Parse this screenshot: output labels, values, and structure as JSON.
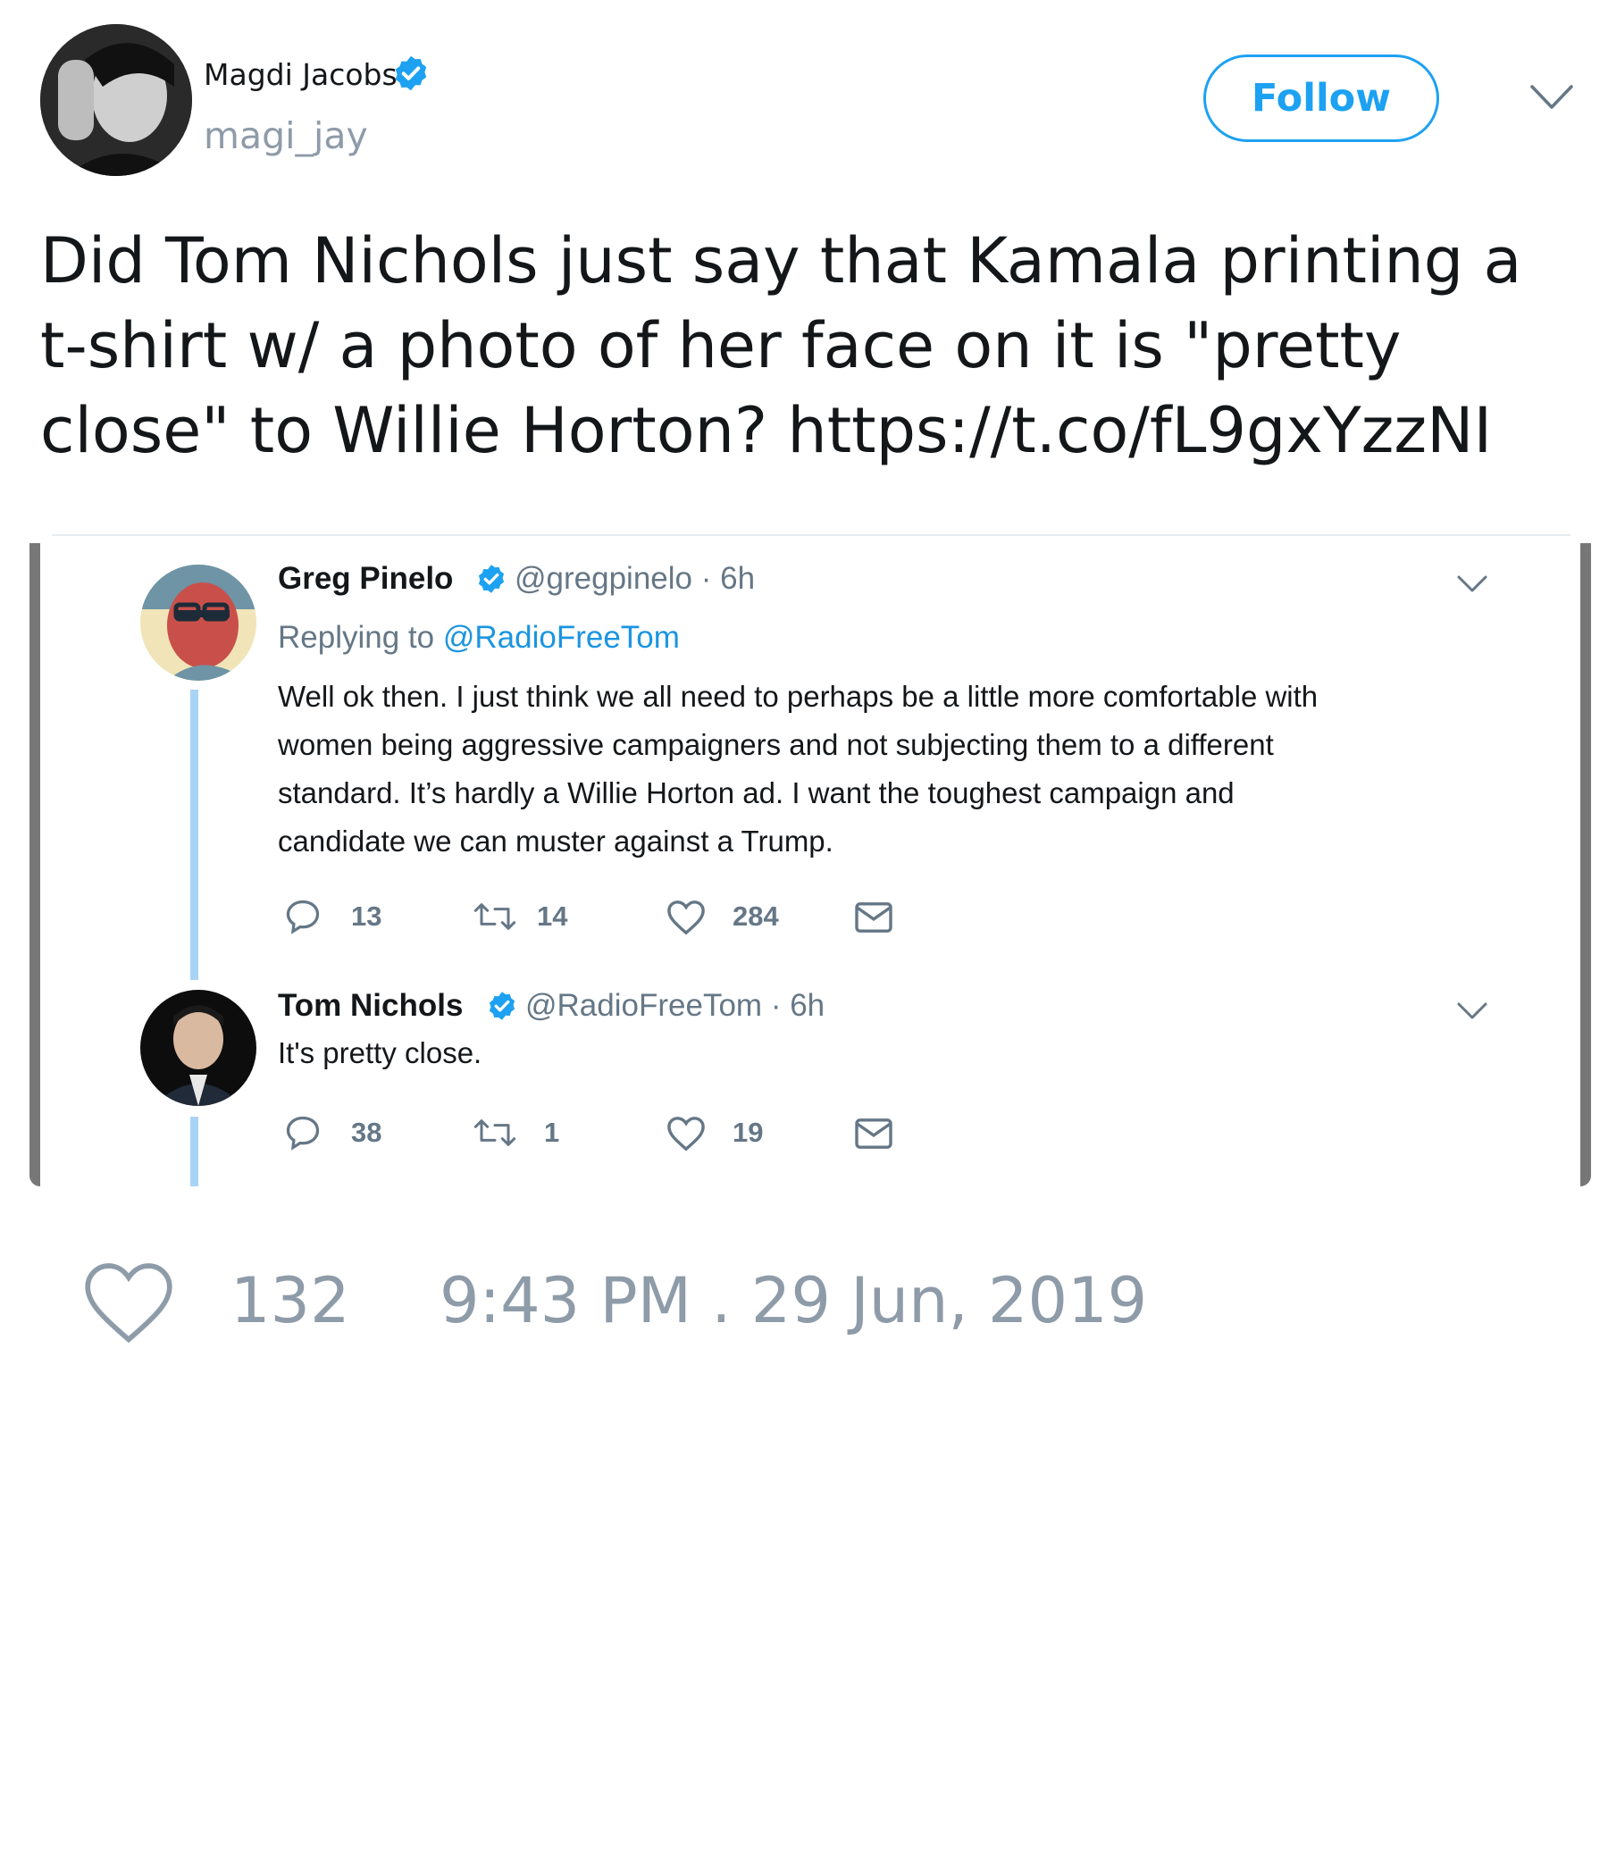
{
  "author": {
    "name": "Magdi Jacobs",
    "handle": "magi_jay",
    "verified": true
  },
  "follow_label": "Follow",
  "tweet_text": "Did Tom Nichols just say that Kamala printing a t-shirt w/ a photo of her face on it is \"pretty close\" to Willie Horton? https://t.co/fL9gxYzzNI",
  "embedded": {
    "reply1": {
      "name": "Greg Pinelo",
      "handle": "@gregpinelo",
      "time": "· 6h",
      "replying_prefix": "Replying to",
      "replying_to": "@RadioFreeTom",
      "lines": [
        "Well ok then. I just think we all need to perhaps be a little more comfortable with",
        "women being aggressive campaigners and not subjecting them to a different",
        "standard. It’s hardly a Willie Horton ad. I want the toughest campaign and",
        "candidate we can muster against a Trump."
      ],
      "replies": "13",
      "retweets": "14",
      "likes": "284"
    },
    "reply2": {
      "name": "Tom Nichols",
      "handle": "@RadioFreeTom",
      "time": "· 6h",
      "text": "It's pretty close.",
      "replies": "38",
      "retweets": "1",
      "likes": "19"
    }
  },
  "footer": {
    "likes": "132",
    "timestamp": "9:43 PM . 29 Jun, 2019"
  },
  "colors": {
    "accent": "#1da1f2",
    "muted": "#8e9ba8",
    "thread": "#a9d3f5"
  }
}
